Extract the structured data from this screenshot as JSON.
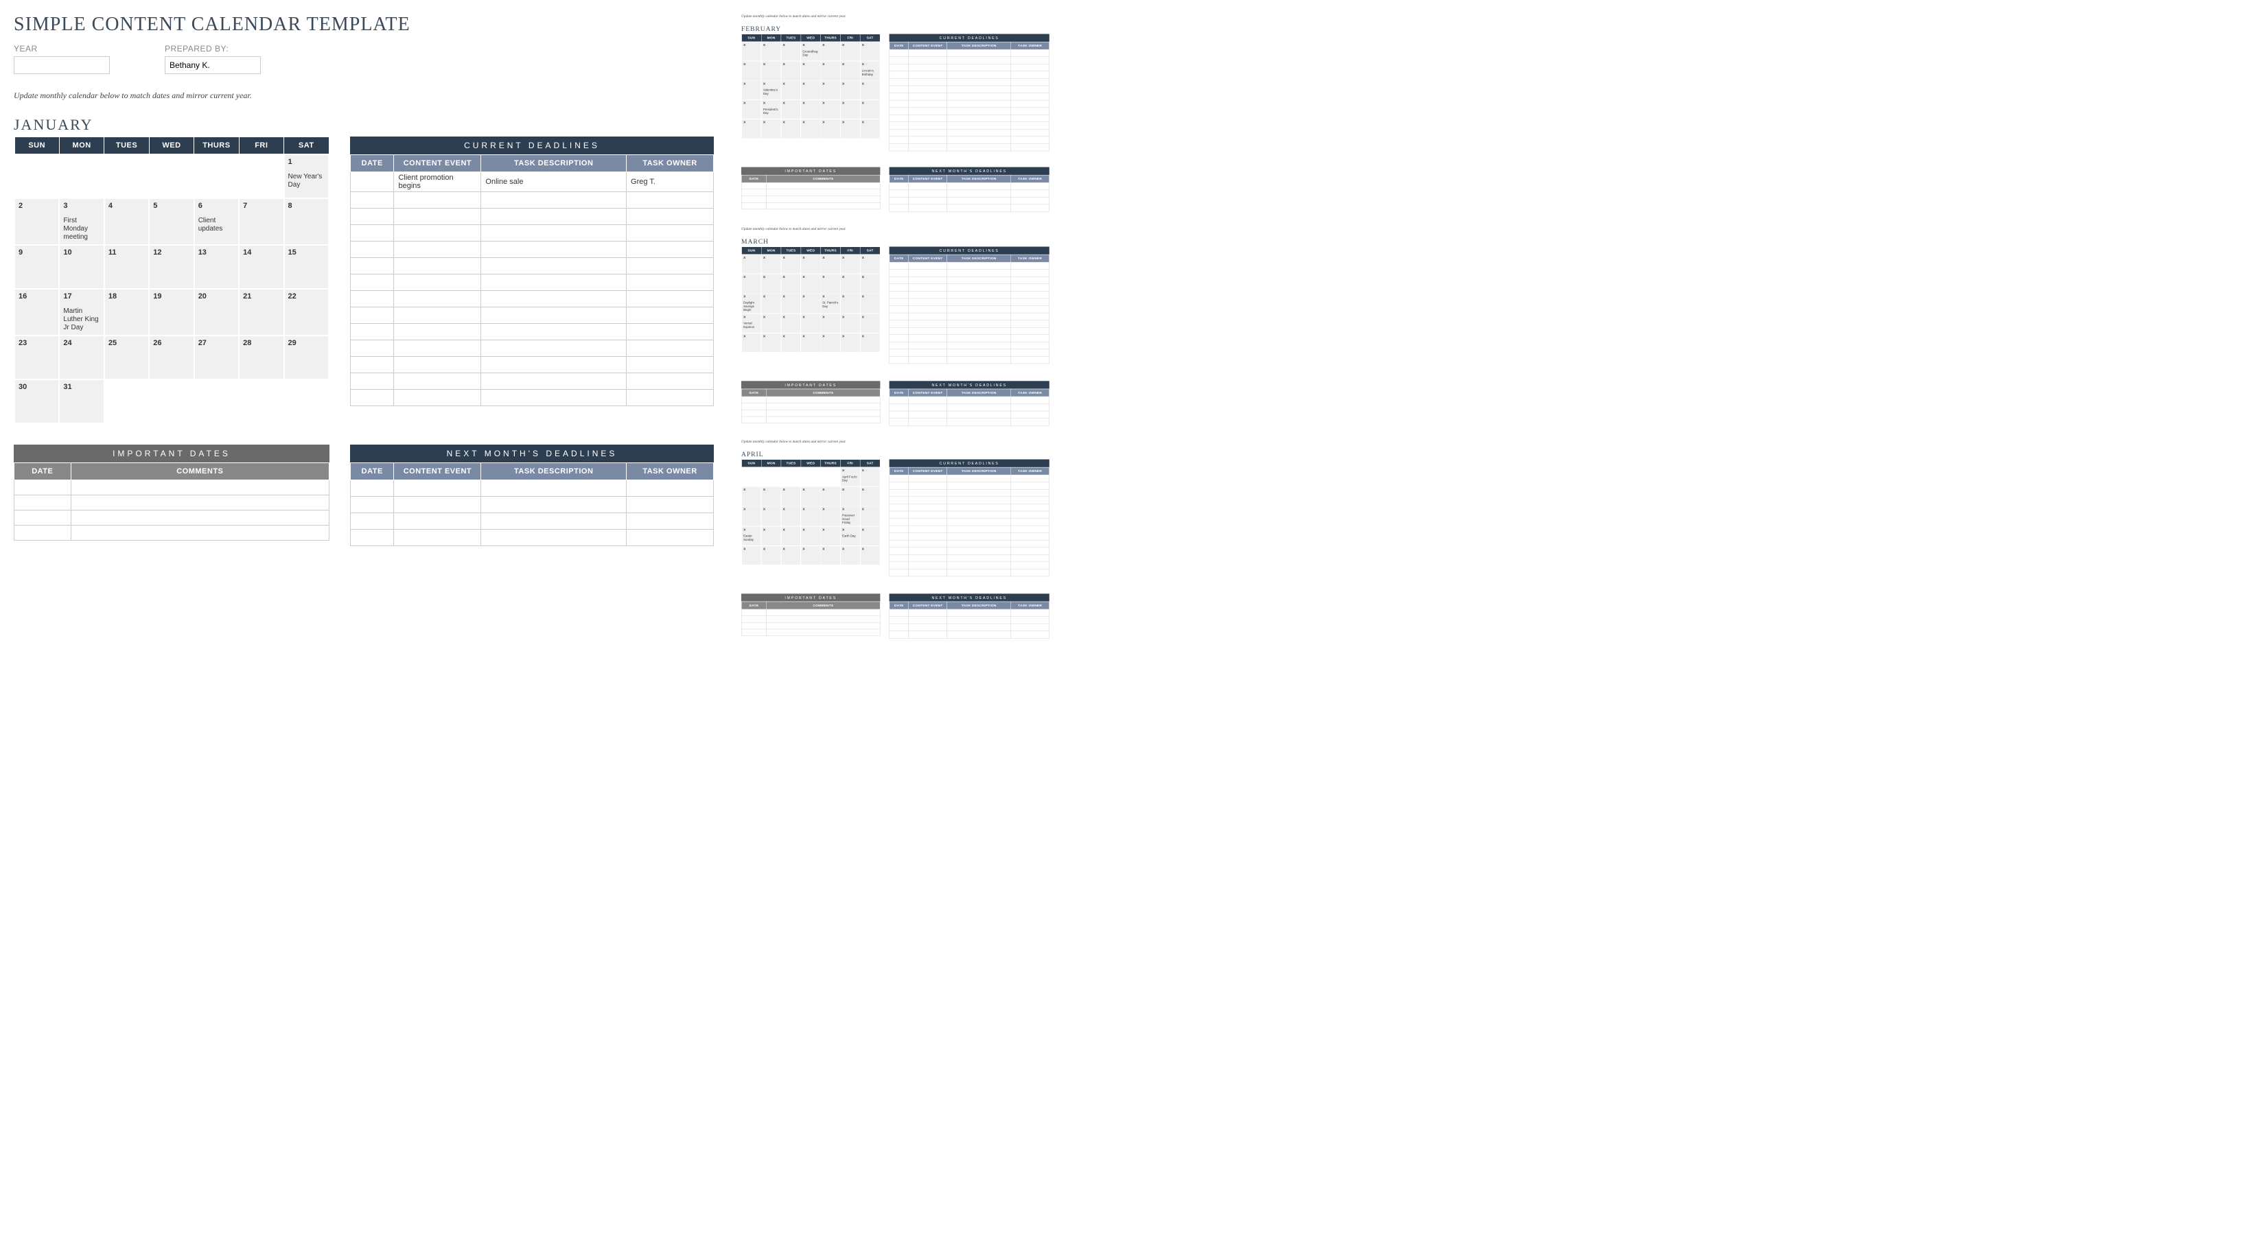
{
  "title": "SIMPLE CONTENT CALENDAR TEMPLATE",
  "fields": {
    "year_label": "YEAR",
    "year_value": "",
    "prepared_label": "PREPARED BY:",
    "prepared_value": "Bethany K."
  },
  "instruction": "Update monthly calendar below to match dates and mirror current year.",
  "day_headers": [
    "SUN",
    "MON",
    "TUES",
    "WED",
    "THURS",
    "FRI",
    "SAT"
  ],
  "sections": {
    "current_deadlines": "CURRENT DEADLINES",
    "next_deadlines": "NEXT MONTH'S DEADLINES",
    "important_dates": "IMPORTANT DATES",
    "col_date": "DATE",
    "col_event": "CONTENT EVENT",
    "col_task": "TASK DESCRIPTION",
    "col_owner": "TASK OWNER",
    "col_comments": "COMMENTS"
  },
  "months": [
    {
      "name": "JANUARY",
      "grid": [
        [
          null,
          null,
          null,
          null,
          null,
          null,
          {
            "n": "1",
            "e": "New Year's Day"
          }
        ],
        [
          {
            "n": "2"
          },
          {
            "n": "3",
            "e": "First Monday meeting"
          },
          {
            "n": "4"
          },
          {
            "n": "5"
          },
          {
            "n": "6",
            "e": "Client updates"
          },
          {
            "n": "7"
          },
          {
            "n": "8"
          }
        ],
        [
          {
            "n": "9"
          },
          {
            "n": "10"
          },
          {
            "n": "11"
          },
          {
            "n": "12"
          },
          {
            "n": "13"
          },
          {
            "n": "14"
          },
          {
            "n": "15"
          }
        ],
        [
          {
            "n": "16"
          },
          {
            "n": "17",
            "e": "Martin Luther King Jr Day"
          },
          {
            "n": "18"
          },
          {
            "n": "19"
          },
          {
            "n": "20"
          },
          {
            "n": "21"
          },
          {
            "n": "22"
          }
        ],
        [
          {
            "n": "23"
          },
          {
            "n": "24"
          },
          {
            "n": "25"
          },
          {
            "n": "26"
          },
          {
            "n": "27"
          },
          {
            "n": "28"
          },
          {
            "n": "29"
          }
        ],
        [
          {
            "n": "30"
          },
          {
            "n": "31"
          },
          null,
          null,
          null,
          null,
          null
        ]
      ],
      "deadlines": [
        {
          "date": "",
          "event": "Client promotion begins",
          "task": "Online sale",
          "owner": "Greg T."
        }
      ]
    },
    {
      "name": "FEBRUARY",
      "grid": [
        [
          {
            "n": "X"
          },
          {
            "n": "X"
          },
          {
            "n": "X"
          },
          {
            "n": "X",
            "e": "Groundhog Day"
          },
          {
            "n": "X"
          },
          {
            "n": "X"
          },
          {
            "n": "X"
          }
        ],
        [
          {
            "n": "X"
          },
          {
            "n": "X"
          },
          {
            "n": "X"
          },
          {
            "n": "X"
          },
          {
            "n": "X"
          },
          {
            "n": "X"
          },
          {
            "n": "X",
            "e": "Lincoln's Birthday"
          }
        ],
        [
          {
            "n": "X"
          },
          {
            "n": "X",
            "e": "Valentine's Day"
          },
          {
            "n": "X"
          },
          {
            "n": "X"
          },
          {
            "n": "X"
          },
          {
            "n": "X"
          },
          {
            "n": "X"
          }
        ],
        [
          {
            "n": "X"
          },
          {
            "n": "X",
            "e": "President's Day"
          },
          {
            "n": "X"
          },
          {
            "n": "X"
          },
          {
            "n": "X"
          },
          {
            "n": "X"
          },
          {
            "n": "X"
          }
        ],
        [
          {
            "n": "X"
          },
          {
            "n": "X"
          },
          {
            "n": "X"
          },
          {
            "n": "X"
          },
          {
            "n": "X"
          },
          {
            "n": "X"
          },
          {
            "n": "X"
          }
        ],
        [
          null,
          null,
          null,
          null,
          null,
          null,
          null
        ]
      ],
      "deadlines": []
    },
    {
      "name": "MARCH",
      "grid": [
        [
          {
            "n": "X"
          },
          {
            "n": "X"
          },
          {
            "n": "X"
          },
          {
            "n": "X"
          },
          {
            "n": "X"
          },
          {
            "n": "X"
          },
          {
            "n": "X"
          }
        ],
        [
          {
            "n": "X"
          },
          {
            "n": "X"
          },
          {
            "n": "X"
          },
          {
            "n": "X"
          },
          {
            "n": "X"
          },
          {
            "n": "X"
          },
          {
            "n": "X"
          }
        ],
        [
          {
            "n": "X",
            "e": "Daylight Savings Begin"
          },
          {
            "n": "X"
          },
          {
            "n": "X"
          },
          {
            "n": "X"
          },
          {
            "n": "X",
            "e": "St. Patrick's Day"
          },
          {
            "n": "X"
          },
          {
            "n": "X"
          }
        ],
        [
          {
            "n": "X",
            "e": "Vernal Equinox"
          },
          {
            "n": "X"
          },
          {
            "n": "X"
          },
          {
            "n": "X"
          },
          {
            "n": "X"
          },
          {
            "n": "X"
          },
          {
            "n": "X"
          }
        ],
        [
          {
            "n": "X"
          },
          {
            "n": "X"
          },
          {
            "n": "X"
          },
          {
            "n": "X"
          },
          {
            "n": "X"
          },
          {
            "n": "X"
          },
          {
            "n": "X"
          }
        ],
        [
          null,
          null,
          null,
          null,
          null,
          null,
          null
        ]
      ],
      "deadlines": []
    },
    {
      "name": "APRIL",
      "grid": [
        [
          null,
          null,
          null,
          null,
          null,
          {
            "n": "X",
            "e": "April Fool's Day"
          },
          {
            "n": "X"
          }
        ],
        [
          {
            "n": "X"
          },
          {
            "n": "X"
          },
          {
            "n": "X"
          },
          {
            "n": "X"
          },
          {
            "n": "X"
          },
          {
            "n": "X"
          },
          {
            "n": "X"
          }
        ],
        [
          {
            "n": "X"
          },
          {
            "n": "X"
          },
          {
            "n": "X"
          },
          {
            "n": "X"
          },
          {
            "n": "X"
          },
          {
            "n": "X",
            "e": "Passover Good Friday"
          },
          {
            "n": "X"
          }
        ],
        [
          {
            "n": "X",
            "e": "Easter Sunday"
          },
          {
            "n": "X"
          },
          {
            "n": "X"
          },
          {
            "n": "X"
          },
          {
            "n": "X"
          },
          {
            "n": "X",
            "e": "Earth Day"
          },
          {
            "n": "X"
          }
        ],
        [
          {
            "n": "X"
          },
          {
            "n": "X"
          },
          {
            "n": "X"
          },
          {
            "n": "X"
          },
          {
            "n": "X"
          },
          {
            "n": "X"
          },
          {
            "n": "X"
          }
        ],
        [
          null,
          null,
          null,
          null,
          null,
          null,
          null
        ]
      ],
      "deadlines": []
    }
  ]
}
